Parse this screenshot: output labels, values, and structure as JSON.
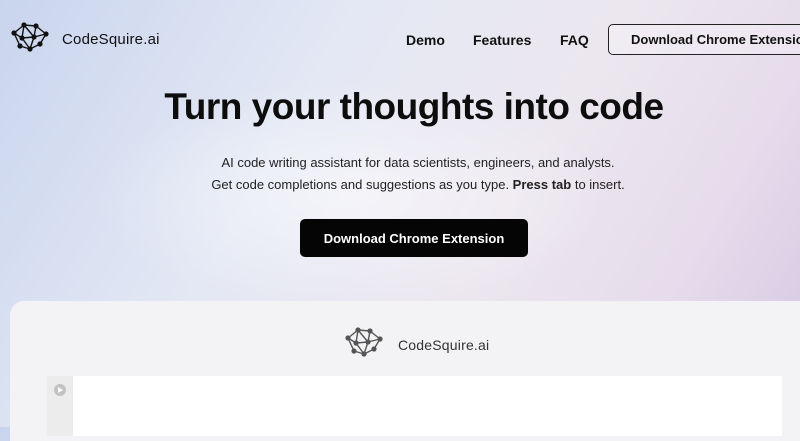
{
  "brand": {
    "name": "CodeSquire.ai",
    "logo_icon": "network-graph-icon"
  },
  "nav": {
    "items": [
      {
        "label": "Demo"
      },
      {
        "label": "Features"
      },
      {
        "label": "FAQ"
      }
    ],
    "cta_label": "Download Chrome Extension"
  },
  "hero": {
    "title": "Turn your thoughts into code",
    "subtitle_line1": "AI code writing assistant for data scientists, engineers, and analysts.",
    "subtitle_line2_pre": "Get code completions and suggestions as you type. ",
    "subtitle_line2_bold": "Press tab",
    "subtitle_line2_post": " to insert.",
    "cta_label": "Download Chrome Extension"
  },
  "demo": {
    "brand_name": "CodeSquire.ai",
    "run_icon": "play-icon"
  },
  "colors": {
    "primary_button": "#050505",
    "text": "#111111",
    "panel_bg": "#f3f3f5"
  }
}
